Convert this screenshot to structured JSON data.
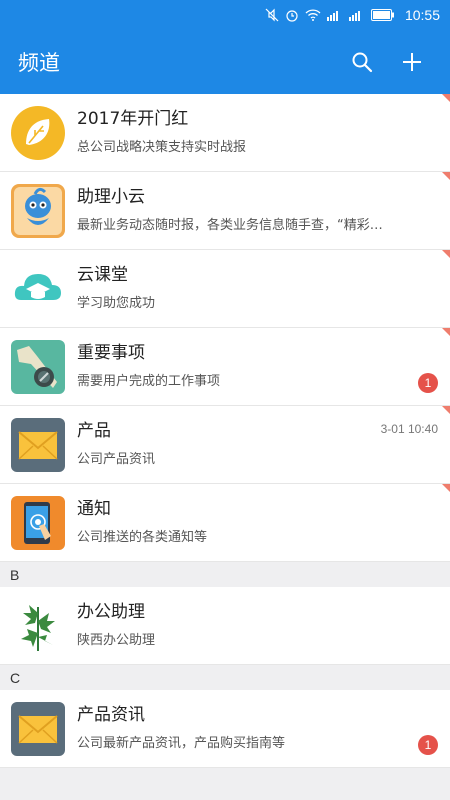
{
  "status_bar": {
    "time": "10:55"
  },
  "app_bar": {
    "title": "频道"
  },
  "channels": [
    {
      "name": "2017年开门红",
      "desc": "总公司战略决策支持实时战报",
      "icon": "leaf-icon"
    },
    {
      "name": "助理小云",
      "desc": "最新业务动态随时报，各类业务信息随手查，“精彩…",
      "icon": "mascot-icon"
    },
    {
      "name": "云课堂",
      "desc": "学习助您成功",
      "icon": "cloud-graduation-cap-icon"
    },
    {
      "name": "重要事项",
      "desc": "需要用户完成的工作事项",
      "icon": "wrench-icon",
      "badge": "1"
    },
    {
      "name": "产品",
      "desc": "公司产品资讯",
      "icon": "envelope-icon",
      "time": "3-01 10:40"
    },
    {
      "name": "通知",
      "desc": "公司推送的各类通知等",
      "icon": "phone-touch-icon"
    }
  ],
  "section_b": {
    "label": "B"
  },
  "channels_b": [
    {
      "name": "办公助理",
      "desc": "陕西办公助理",
      "icon": "plant-icon"
    }
  ],
  "section_c": {
    "label": "C"
  },
  "channels_c": [
    {
      "name": "产品资讯",
      "desc": "公司最新产品资讯，产品购买指南等",
      "icon": "envelope-icon",
      "badge": "1"
    }
  ],
  "colors": {
    "primary": "#1e88e5",
    "badge": "#e5524a",
    "corner": "#ef7d6d"
  }
}
